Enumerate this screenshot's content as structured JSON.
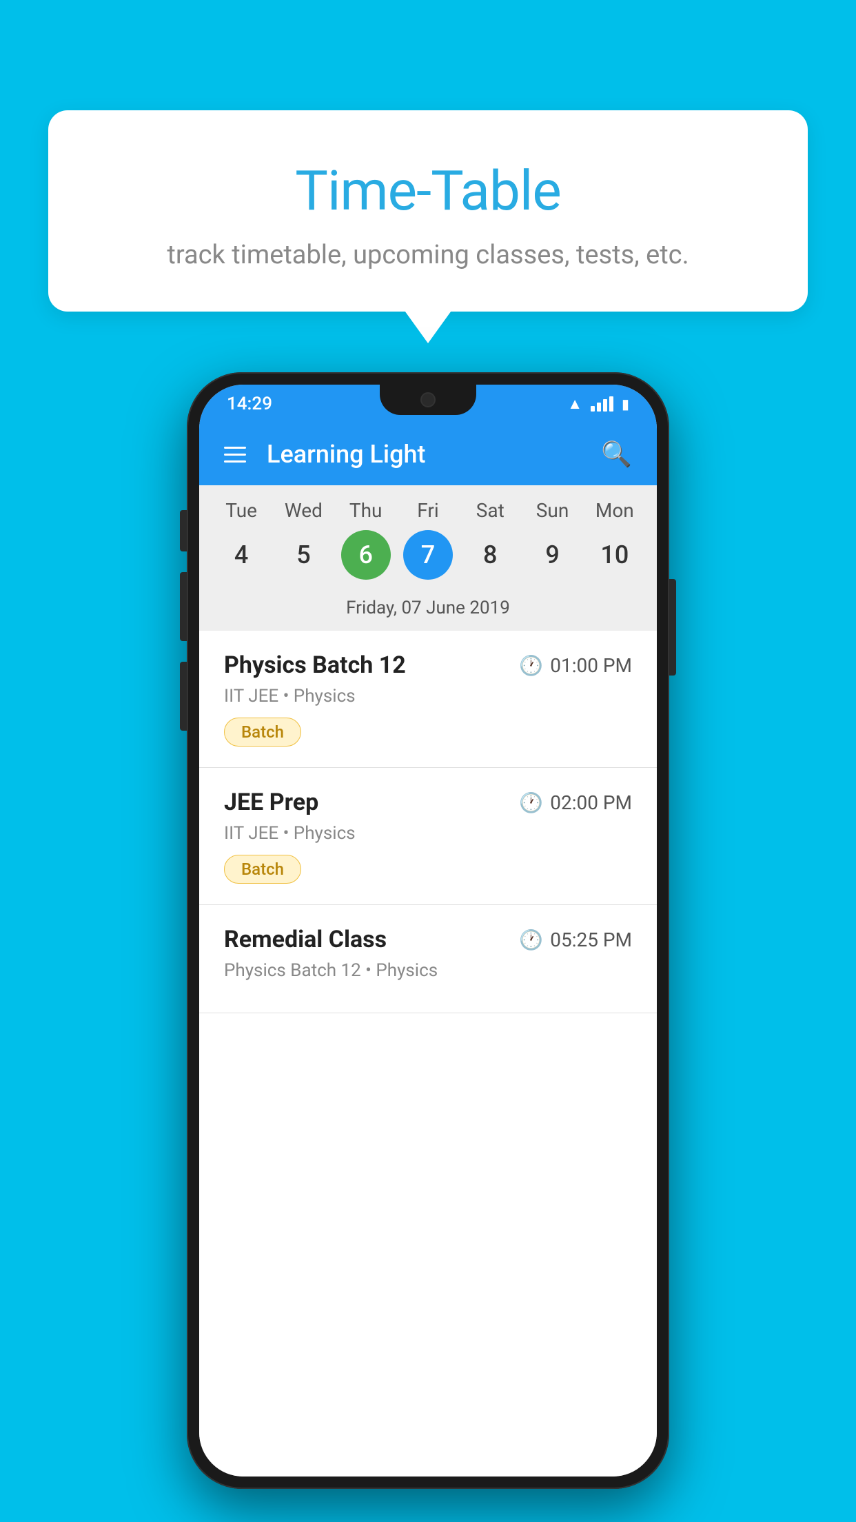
{
  "background_color": "#00BFEA",
  "tooltip": {
    "title": "Time-Table",
    "subtitle": "track timetable, upcoming classes, tests, etc."
  },
  "phone": {
    "status_bar": {
      "time": "14:29"
    },
    "header": {
      "title": "Learning Light"
    },
    "calendar": {
      "days": [
        "Tue",
        "Wed",
        "Thu",
        "Fri",
        "Sat",
        "Sun",
        "Mon"
      ],
      "dates": [
        {
          "date": "4",
          "state": "normal"
        },
        {
          "date": "5",
          "state": "normal"
        },
        {
          "date": "6",
          "state": "today"
        },
        {
          "date": "7",
          "state": "selected"
        },
        {
          "date": "8",
          "state": "normal"
        },
        {
          "date": "9",
          "state": "normal"
        },
        {
          "date": "10",
          "state": "normal"
        }
      ],
      "selected_date_label": "Friday, 07 June 2019"
    },
    "schedule": [
      {
        "name": "Physics Batch 12",
        "time": "01:00 PM",
        "meta": "IIT JEE • Physics",
        "badge": "Batch"
      },
      {
        "name": "JEE Prep",
        "time": "02:00 PM",
        "meta": "IIT JEE • Physics",
        "badge": "Batch"
      },
      {
        "name": "Remedial Class",
        "time": "05:25 PM",
        "meta": "Physics Batch 12 • Physics",
        "badge": ""
      }
    ]
  }
}
